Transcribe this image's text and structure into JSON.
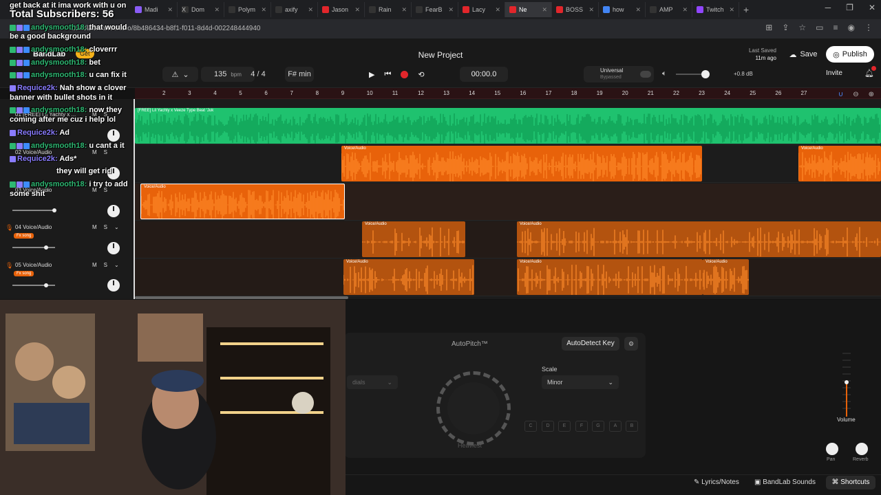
{
  "browser": {
    "tabs": [
      {
        "label": "Madi",
        "color": "#8a5cf6"
      },
      {
        "label": "Dom",
        "color": "#cccccc"
      },
      {
        "label": "Polym",
        "color": "#cccccc"
      },
      {
        "label": "axify",
        "color": "#cccccc"
      },
      {
        "label": "Jason",
        "color": "#e2262b"
      },
      {
        "label": "Rain",
        "color": "#cccccc"
      },
      {
        "label": "FearB",
        "color": "#cccccc"
      },
      {
        "label": "Lacy",
        "color": "#e2262b"
      },
      {
        "label": "Ne",
        "color": "#e2262b"
      },
      {
        "label": "BOSS",
        "color": "#e2262b"
      },
      {
        "label": "how",
        "color": "#4285f4"
      },
      {
        "label": "AMP",
        "color": "#cccccc"
      },
      {
        "label": "Twitch",
        "color": "#9146ff"
      }
    ],
    "url": "bandlab.com/studio/8b486434-b8f1-f011-8d4d-002248444940"
  },
  "header": {
    "logo": "BandLab",
    "get_label": "Get",
    "project_title": "New Project",
    "last_saved_label": "Last Saved",
    "last_saved_value": "11m ago",
    "save_label": "Save",
    "publish_label": "Publish",
    "invite_label": "Invite",
    "tempo": "135",
    "tempo_unit": "bpm",
    "time_sig": "4 / 4",
    "key": "F# min",
    "timecode": "00:00.0",
    "universal_label": "Universal",
    "universal_sub": "Bypassed",
    "volume_db": "+0.8 dB"
  },
  "ruler": {
    "ticks": [
      "2",
      "3",
      "4",
      "5",
      "6",
      "7",
      "8",
      "9",
      "10",
      "11",
      "12",
      "13",
      "14",
      "15",
      "16",
      "17",
      "18",
      "19",
      "20",
      "21",
      "22",
      "23",
      "24",
      "25",
      "26",
      "27"
    ]
  },
  "tracks": [
    {
      "name": "01 [FREE] Lil Yachty x ...",
      "fx": "",
      "clip_name": "[FREE] Lil Yachty x Veeze Type Beat 'Juk"
    },
    {
      "name": "02 Voice/Audio",
      "fx": "Fx song",
      "clip_name": "Voice/Audio"
    },
    {
      "name": "03 Voice/Audio",
      "fx": "Fx song",
      "clip_name": "Voice/Audio"
    },
    {
      "name": "04 Voice/Audio",
      "fx": "Fx song",
      "clip_name": "Voice/Audio"
    },
    {
      "name": "05 Voice/Audio",
      "fx": "Fx song",
      "clip_name": "Voice/Audio"
    }
  ],
  "autopitch": {
    "title": "AutoPitch™",
    "autodetect_label": "AutoDetect Key",
    "scale_label": "Scale",
    "scale_value": "Minor",
    "style_value": "dials",
    "knob_label": "Heaviest",
    "keys": [
      "C",
      "D",
      "E",
      "F",
      "G",
      "A",
      "B"
    ]
  },
  "mixer": {
    "volume_label": "Volume",
    "pan_label": "Pan",
    "reverb_label": "Reverb"
  },
  "footer": {
    "lyrics_label": "Lyrics/Notes",
    "sounds_label": "BandLab Sounds",
    "shortcuts_label": "Shortcuts"
  },
  "chat": {
    "title": "Total Subscribers: 56",
    "messages": [
      {
        "user": "",
        "text": "get back at it ima work with u on"
      },
      {
        "user": "andysmooth18:",
        "text": "that would"
      },
      {
        "user": "",
        "text": "be a good background"
      },
      {
        "user": "andysmooth18:",
        "text": "cloverrr"
      },
      {
        "user": "andysmooth18:",
        "text": "bet"
      },
      {
        "user": "andysmooth18:",
        "text": "u can fix it"
      },
      {
        "user": "Requice2k:",
        "text": "Nah show a clover"
      },
      {
        "user": "",
        "text": "banner with bullet shots in it"
      },
      {
        "user": "andysmooth18:",
        "text": "now they"
      },
      {
        "user": "",
        "text": "coming after me cuz i help lol"
      },
      {
        "user": "Requice2k:",
        "text": "Ad"
      },
      {
        "user": "andysmooth18:",
        "text": "u cant a it"
      },
      {
        "user": "Requice2k:",
        "text": "Ads*"
      },
      {
        "user": "",
        "text": "they will get rid"
      },
      {
        "user": "andysmooth18:",
        "text": "i try to add"
      },
      {
        "user": "",
        "text": "some shit"
      }
    ]
  },
  "colors": {
    "accent_red": "#e2262b",
    "clip_green": "#1fc26f",
    "clip_orange": "#e8620a",
    "chat_green": "#2eb872"
  }
}
